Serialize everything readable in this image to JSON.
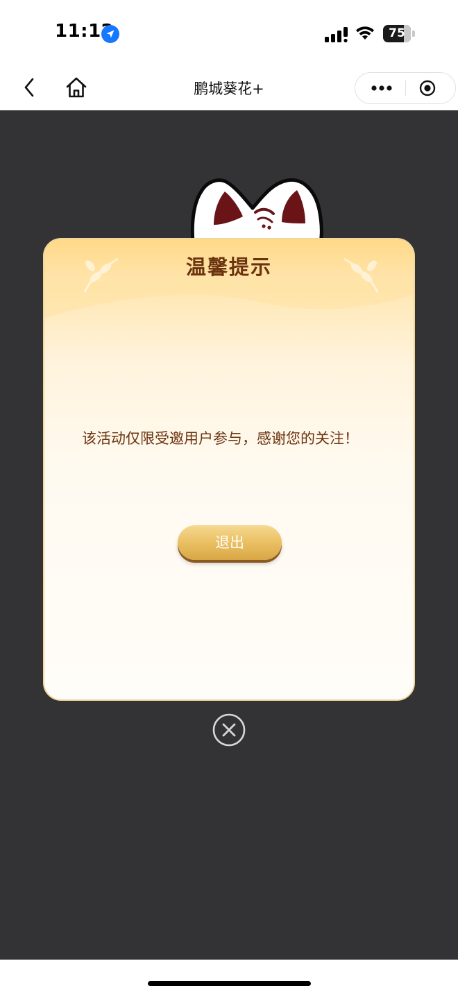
{
  "status_bar": {
    "time": "11:12",
    "battery": "75",
    "battery_level": 0.75
  },
  "nav": {
    "title": "鹏城葵花+"
  },
  "dialog": {
    "title": "温馨提示",
    "message": "该活动仅限受邀用户参与，感谢您的关注！",
    "exit_label": "退出"
  },
  "colors": {
    "overlay": "#333335",
    "dialog_text": "#6b3410",
    "button_gold": "#e8bd5f"
  },
  "icons": {
    "location": "location-arrow-icon",
    "signal": "cellular-signal-icon",
    "wifi": "wifi-icon",
    "back": "chevron-left-icon",
    "home": "home-icon",
    "more": "more-dots-icon",
    "close_capsule": "record-circle-icon",
    "dialog_close": "close-circle-icon"
  }
}
